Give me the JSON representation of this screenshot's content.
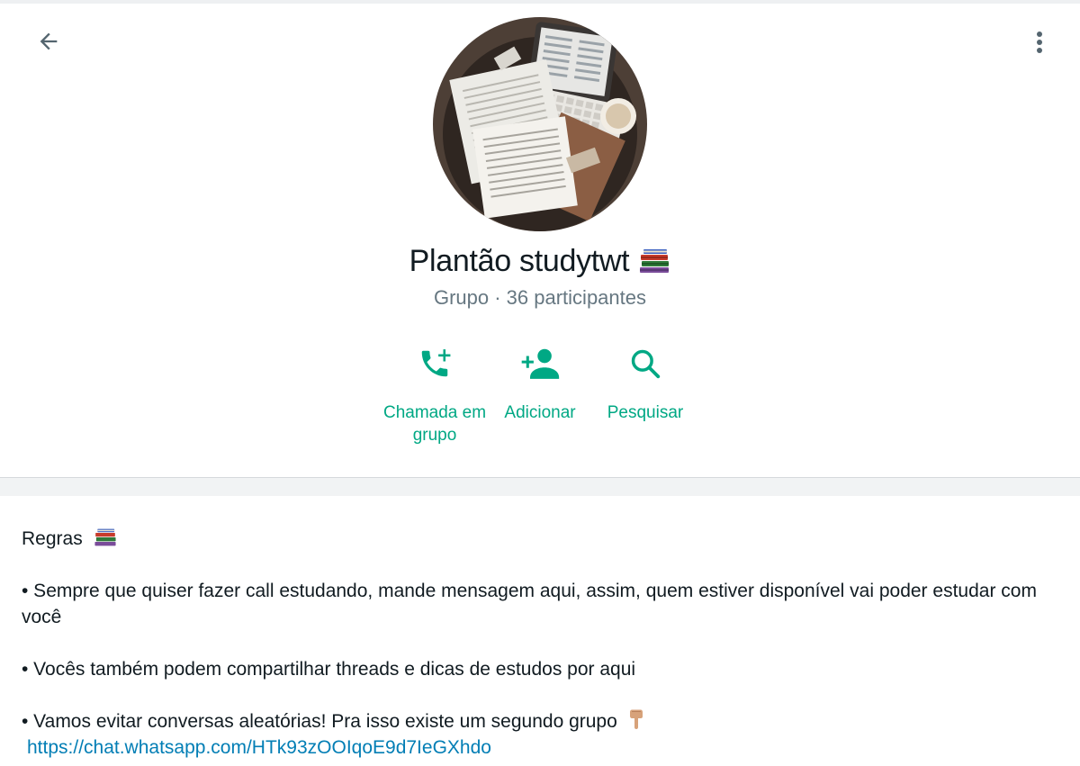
{
  "header": {
    "title": "Plantão studytwt",
    "title_emoji": "books-icon",
    "subtitle": "Grupo · 36 participantes"
  },
  "actions": [
    {
      "label": "Chamada em grupo",
      "icon": "add-call-icon"
    },
    {
      "label": "Adicionar",
      "icon": "add-person-icon"
    },
    {
      "label": "Pesquisar",
      "icon": "search-icon"
    }
  ],
  "description": {
    "heading": "Regras",
    "rule1": "• Sempre que quiser fazer call estudando, mande mensagem aqui,  assim, quem estiver disponível vai poder estudar com você",
    "rule2": "• Vocês também podem compartilhar threads e dicas de estudos por aqui",
    "rule3": "• Vamos evitar conversas aleatórias! Pra isso existe um segundo grupo",
    "link": "https://chat.whatsapp.com/HTk93zOOIqoE9d7IeGXhdo"
  },
  "colors": {
    "accent": "#00a884",
    "link": "#027eb5",
    "text": "#111b21",
    "secondary_text": "#667781"
  }
}
